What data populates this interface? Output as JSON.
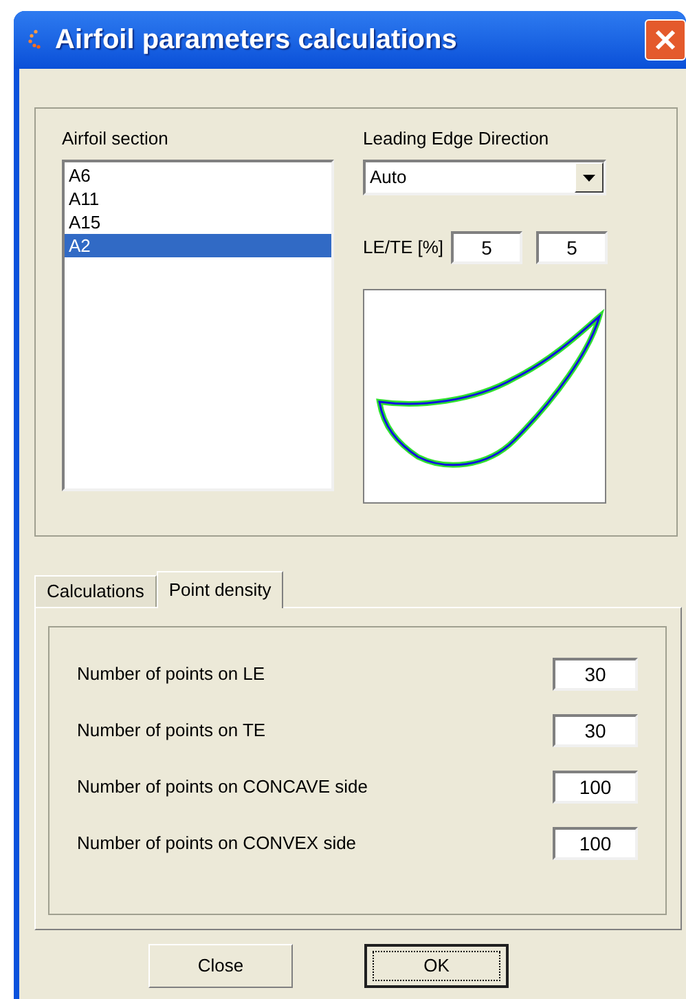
{
  "window": {
    "title": "Airfoil parameters calculations"
  },
  "airfoil_section": {
    "label": "Airfoil section",
    "items": [
      {
        "label": "A6",
        "selected": false
      },
      {
        "label": "A11",
        "selected": false
      },
      {
        "label": "A15",
        "selected": false
      },
      {
        "label": "A2",
        "selected": true
      }
    ]
  },
  "leading_edge_direction": {
    "label": "Leading Edge Direction",
    "value": "Auto"
  },
  "le_te": {
    "label": "LE/TE [%]",
    "values": [
      "5",
      "5"
    ]
  },
  "tabs": [
    {
      "label": "Calculations",
      "selected": false
    },
    {
      "label": "Point density",
      "selected": true
    }
  ],
  "point_density": [
    {
      "label": "Number of points on LE",
      "value": "30"
    },
    {
      "label": "Number of points on TE",
      "value": "30"
    },
    {
      "label": "Number of points on CONCAVE side",
      "value": "100"
    },
    {
      "label": "Number of points on CONVEX side",
      "value": "100"
    }
  ],
  "buttons": [
    {
      "label": "Close",
      "default": false
    },
    {
      "label": "OK",
      "default": true
    }
  ]
}
